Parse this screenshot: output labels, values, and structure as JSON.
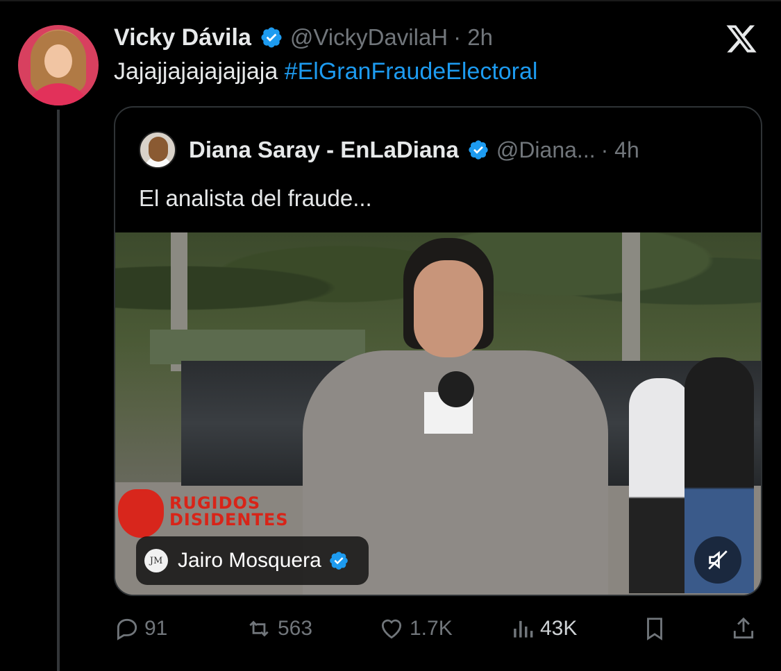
{
  "tweet": {
    "author_name": "Vicky Dávila",
    "handle": "@VickyDavilaH",
    "time": "· 2h",
    "text": "Jajajjajajajajjaja",
    "hashtag": "#ElGranFraudeElectoral"
  },
  "quoted": {
    "author_name": "Diana Saray - EnLaDiana",
    "handle": "@Diana...",
    "time": "· 4h",
    "text": "El analista del fraude...",
    "video": {
      "watermark_line1": "RUGIDOS",
      "watermark_line2": "DISIDENTES",
      "credit_avatar_initials": "JM",
      "credit_name": "Jairo Mosquera",
      "muted": true
    }
  },
  "actions": {
    "replies": "91",
    "retweets": "563",
    "likes": "1.7K",
    "views": "43K"
  },
  "colors": {
    "background": "#000000",
    "text": "#e7e9ea",
    "secondary": "#71767b",
    "accent": "#1d9bf0",
    "border": "#2f3336"
  },
  "icons": [
    "x-logo",
    "verified-badge-icon",
    "reply-icon",
    "retweet-icon",
    "like-icon",
    "views-icon",
    "bookmark-icon",
    "share-icon",
    "mute-icon"
  ]
}
